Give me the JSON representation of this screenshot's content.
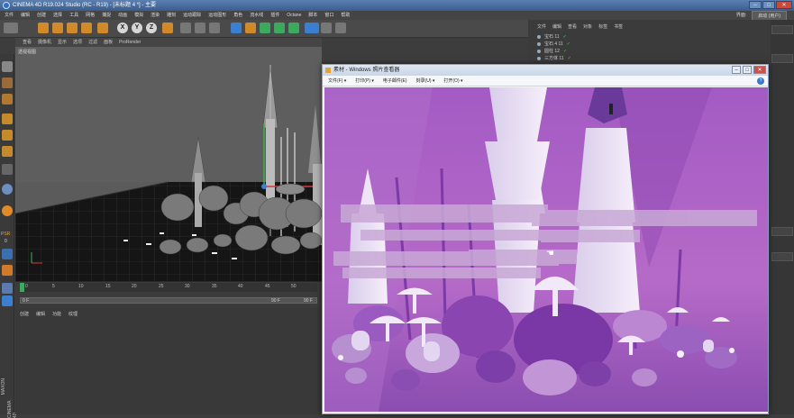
{
  "window": {
    "title": "CINEMA 4D R19.024 Studio (RC - R19) - [未标题 4 *] - 主要"
  },
  "menubar": {
    "items": [
      "文件",
      "编辑",
      "创建",
      "选择",
      "工具",
      "网格",
      "捕捉",
      "动画",
      "模拟",
      "渲染",
      "雕刻",
      "运动跟踪",
      "运动图形",
      "角色",
      "流水线",
      "插件",
      "Octane",
      "脚本",
      "窗口",
      "帮助"
    ],
    "layout_label": "界面:",
    "layout_value": "启动 (用户)"
  },
  "toolbar": {
    "axis_x": "X",
    "axis_y": "Y",
    "axis_z": "Z"
  },
  "viewport": {
    "menu": [
      "查看",
      "摄像机",
      "显示",
      "选项",
      "过滤",
      "面板",
      "ProRender"
    ],
    "label": "透视视图"
  },
  "timeline": {
    "ticks": [
      "0",
      "5",
      "10",
      "15",
      "20",
      "25",
      "30",
      "35",
      "40",
      "45",
      "50"
    ],
    "start_frame": "0 F",
    "end_frame": "90 F",
    "end_frame2": "90 F"
  },
  "material": {
    "menu": [
      "创建",
      "编辑",
      "功能",
      "纹理"
    ]
  },
  "object_manager": {
    "menu": [
      "文件",
      "编辑",
      "查看",
      "对象",
      "标签",
      "书签"
    ],
    "rows": [
      "宝石 11",
      "宝石 4 11",
      "圆柱 12",
      "三方体 11"
    ]
  },
  "photo_viewer": {
    "title": "素材 - Windows 照片查看器",
    "menu": [
      "文件(F) ▾",
      "打印(P) ▾",
      "电子邮件(E)",
      "刻录(U) ▾",
      "打开(O) ▾"
    ],
    "help": "?"
  },
  "side_labels": {
    "maxon": "MAXON",
    "cinema": "CINEMA 4D",
    "psr": "PSR",
    "psr_value": "0"
  },
  "colors": {
    "accent": "#3a7fd0",
    "scene_bg": "#9a5ec2",
    "title_blue": "#3a5d8c"
  }
}
